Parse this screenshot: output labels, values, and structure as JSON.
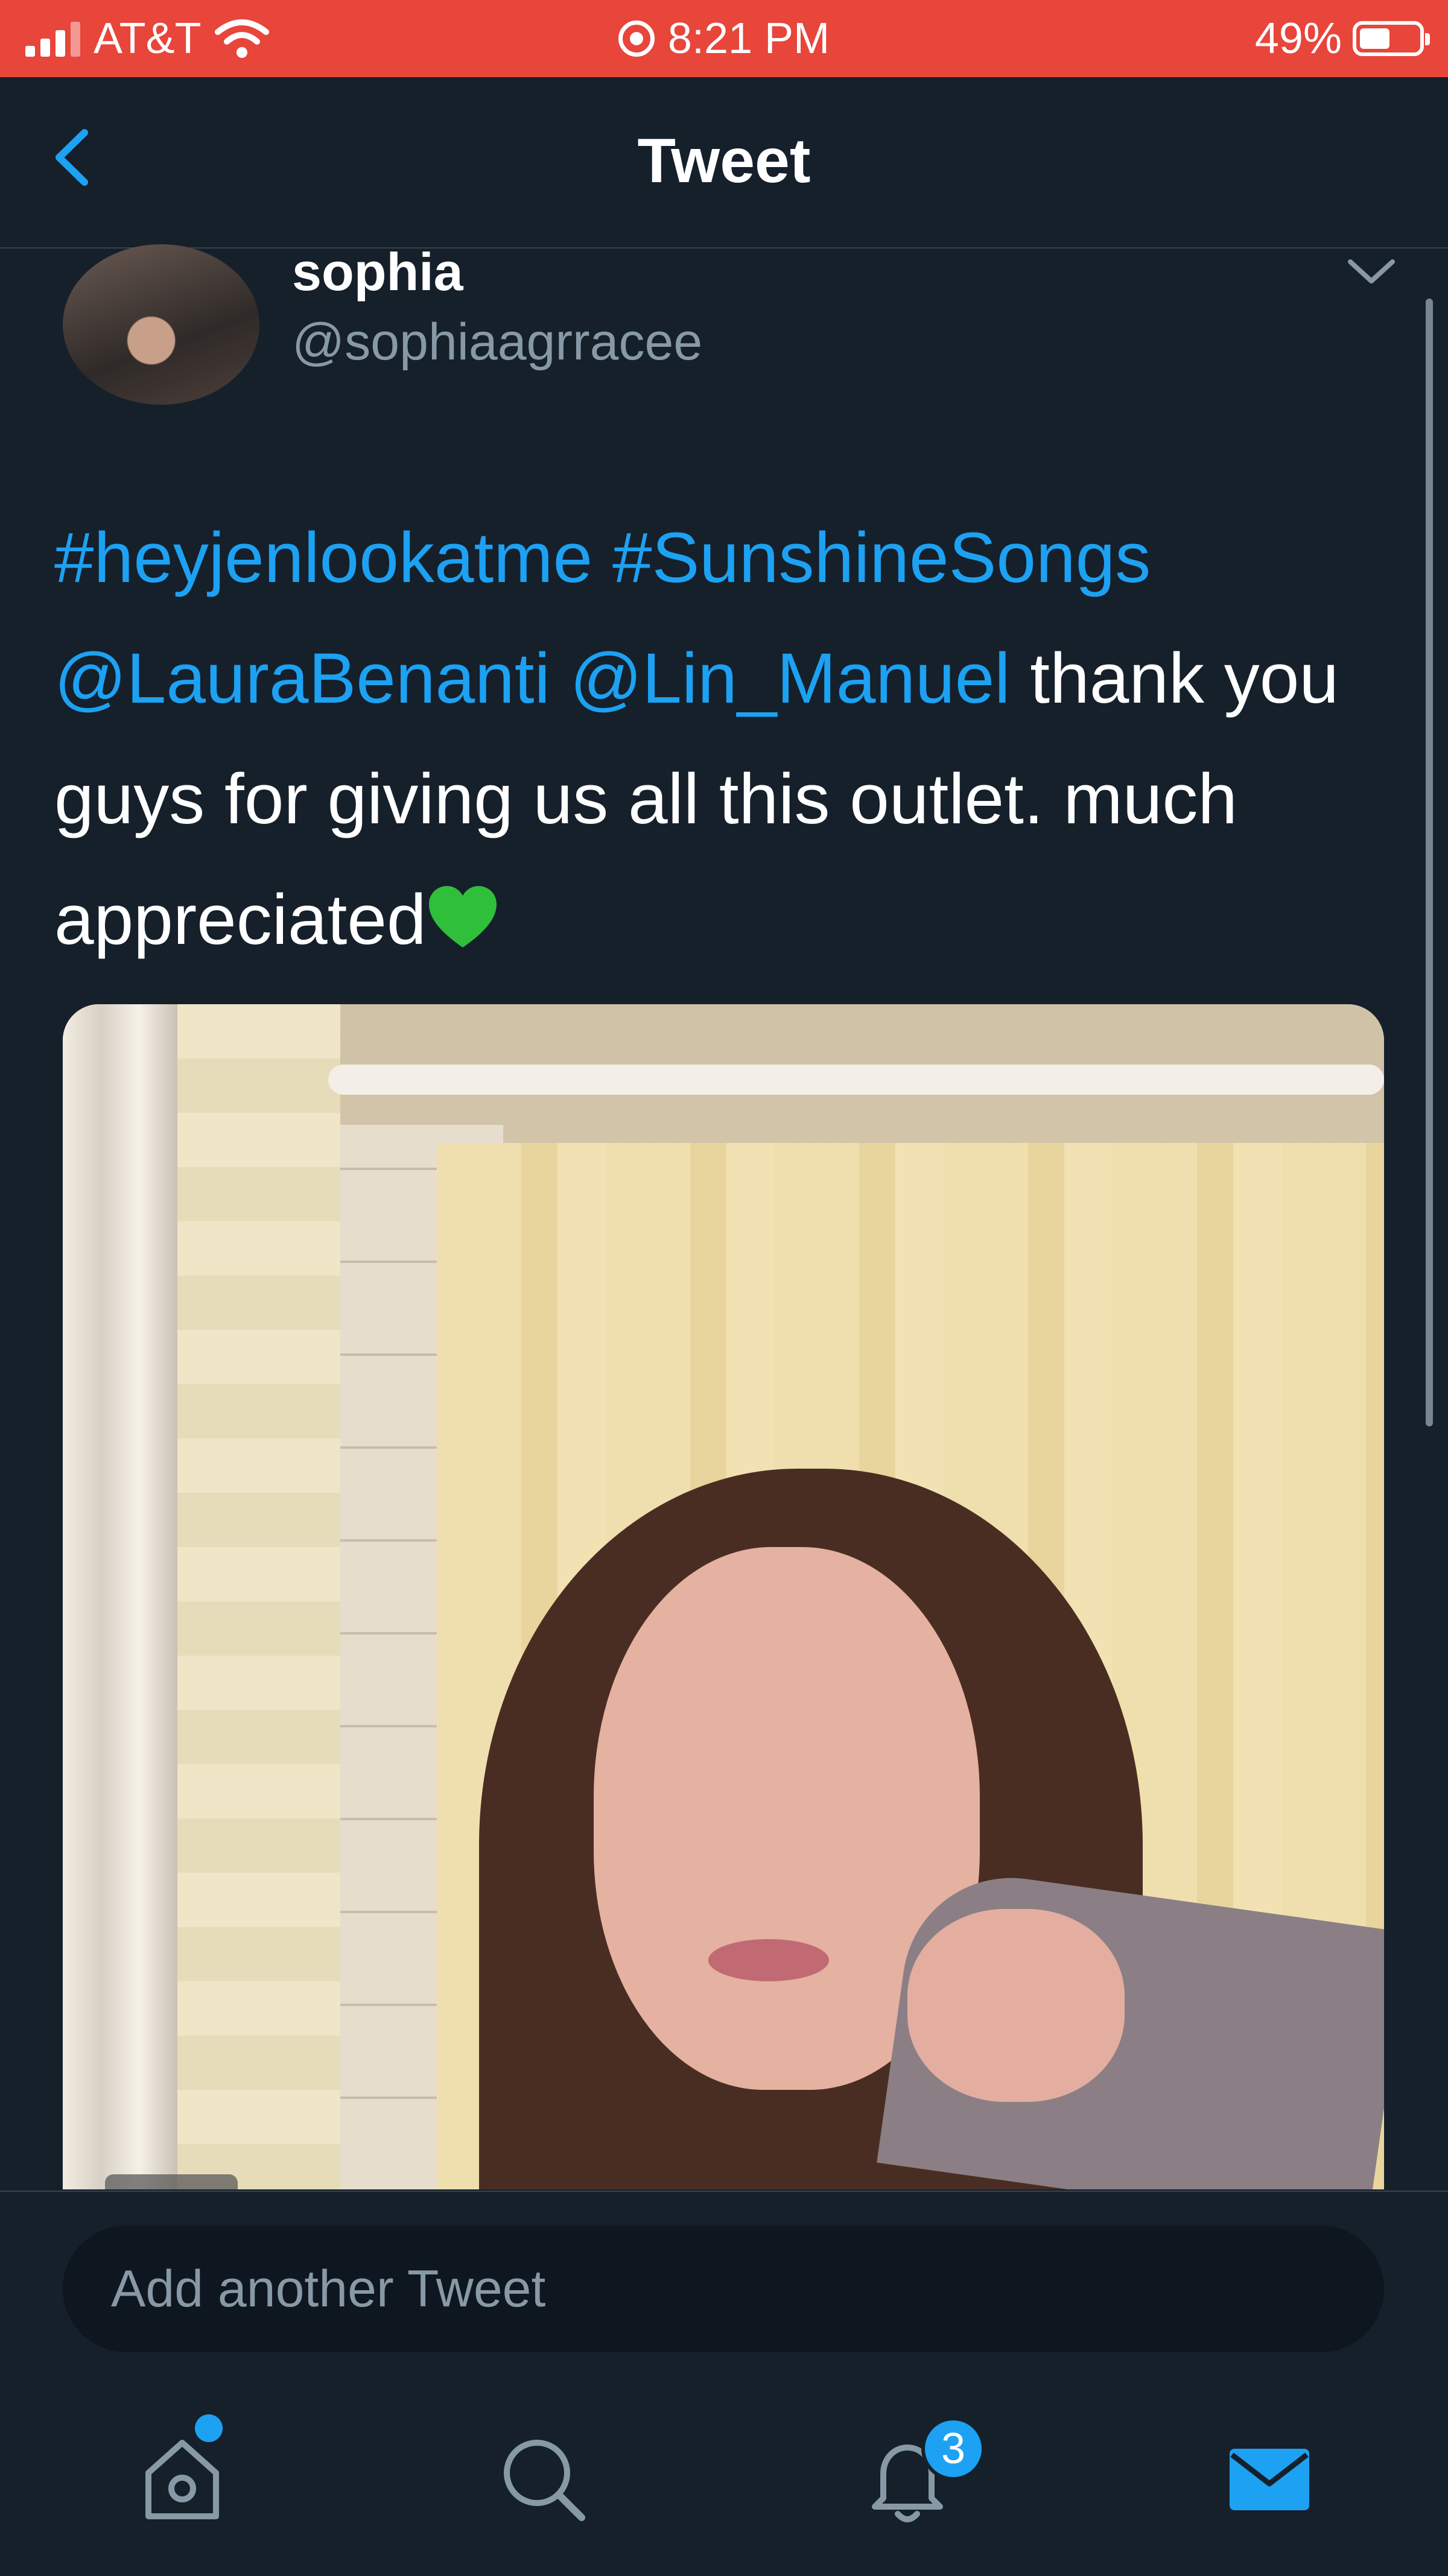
{
  "status_bar": {
    "carrier": "AT&T",
    "time": "8:21 PM",
    "battery": "49%",
    "icons": [
      "signal-icon",
      "wifi-icon",
      "recording-icon",
      "battery-icon"
    ]
  },
  "header": {
    "title": "Tweet",
    "back_icon": "chevron-left-icon"
  },
  "tweet": {
    "author_name": "sophia",
    "author_handle": "@sophiaagrracee",
    "menu_icon": "chevron-down-icon",
    "hashtag1": "#heyjenlookatme",
    "hashtag2": "#SunshineSongs",
    "mention1": "@LauraBenanti",
    "mention2": "@Lin_Manuel",
    "text_part1": " thank you guys for giving us all this outlet. much appreciated",
    "emoji": "green-heart-icon"
  },
  "compose": {
    "placeholder": "Add another Tweet"
  },
  "tab_bar": {
    "items": [
      "home-icon",
      "search-icon",
      "notifications-icon",
      "messages-icon"
    ],
    "notification_count": "3"
  },
  "colors": {
    "accent": "#1da1f2",
    "background": "#15202b",
    "status_bar": "#e8453b",
    "secondary_text": "#8899a6"
  }
}
